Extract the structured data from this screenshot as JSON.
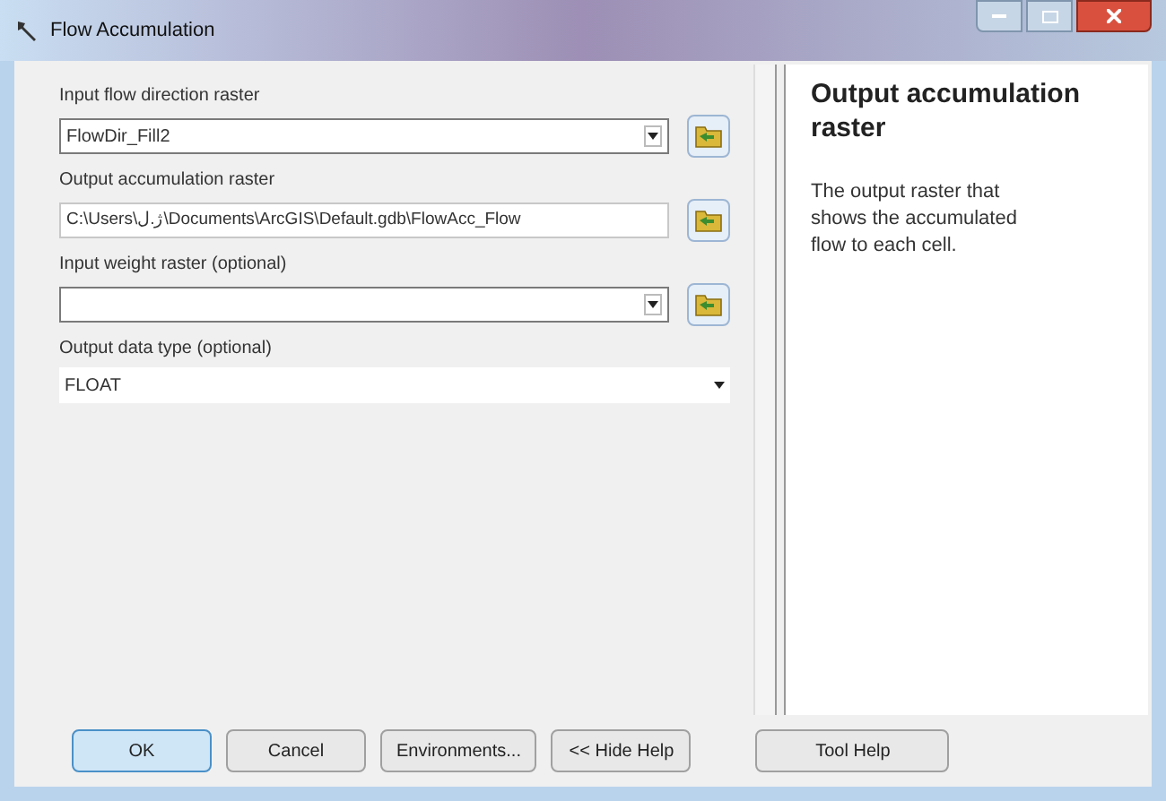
{
  "window": {
    "title": "Flow Accumulation"
  },
  "parameters": [
    {
      "label": "Input flow direction raster",
      "kind": "combo",
      "value": "FlowDir_Fill2"
    },
    {
      "label": "Output accumulation raster",
      "kind": "text",
      "value": "C:\\Users\\ژ.ل\\Documents\\ArcGIS\\Default.gdb\\FlowAcc_Flow"
    },
    {
      "label": "Input weight raster (optional)",
      "kind": "combo"
    },
    {
      "label": "Output data type (optional)",
      "kind": "select",
      "value": "FLOAT"
    }
  ],
  "help": {
    "title": "Output accumulation raster",
    "text": "The output raster that shows the accumulated flow to each cell."
  },
  "buttons": [
    {
      "label": "OK",
      "default": true
    },
    {
      "label": "Cancel",
      "default": false
    },
    {
      "label": "Environments...",
      "default": false
    },
    {
      "label": "<< Hide Help",
      "default": false
    }
  ],
  "help_button": "Tool Help"
}
